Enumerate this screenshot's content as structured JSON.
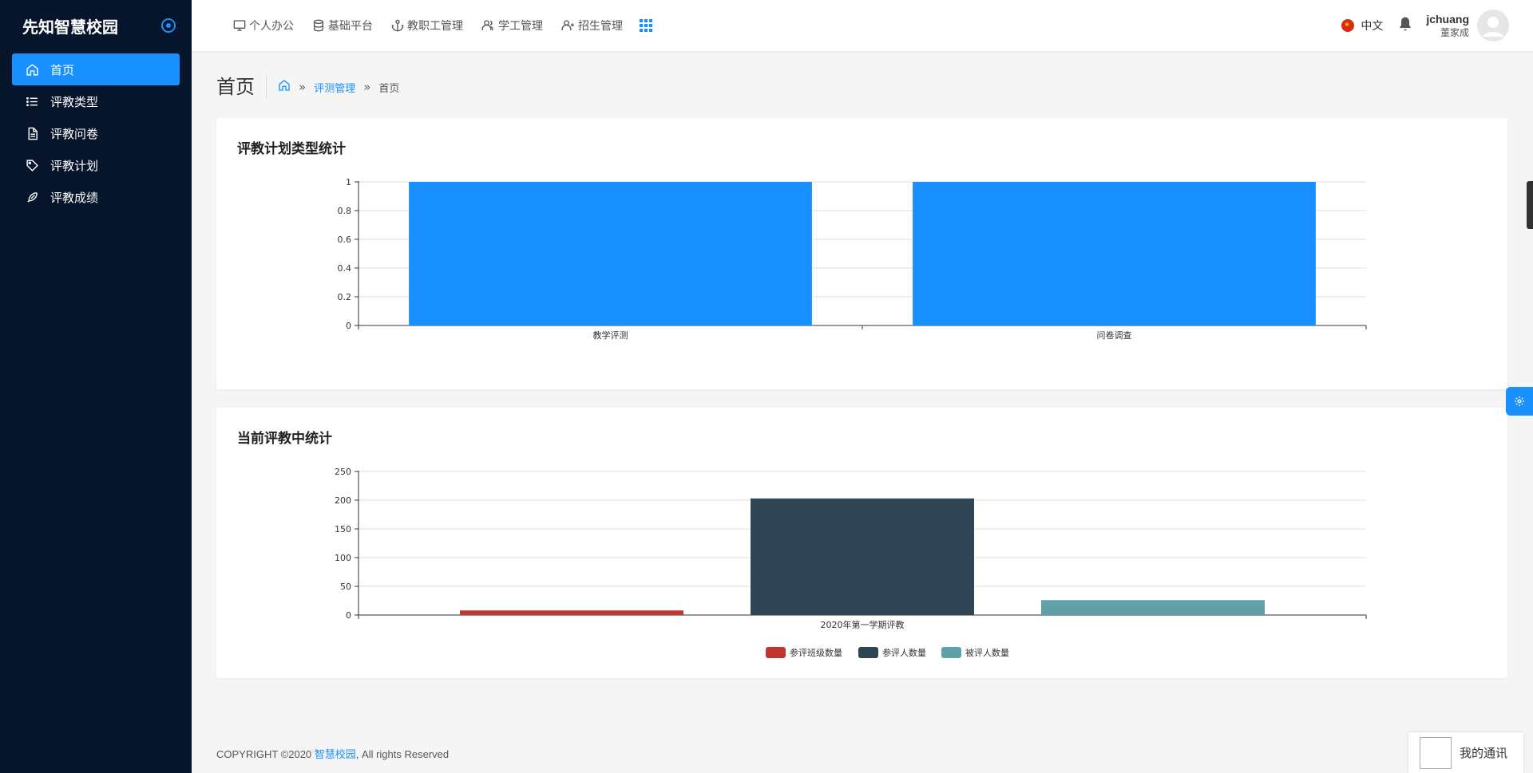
{
  "sidebar": {
    "brand": "先知智慧校园",
    "items": [
      {
        "label": "首页",
        "icon": "home-icon",
        "active": true
      },
      {
        "label": "评教类型",
        "icon": "list-icon",
        "active": false
      },
      {
        "label": "评教问卷",
        "icon": "document-icon",
        "active": false
      },
      {
        "label": "评教计划",
        "icon": "tag-icon",
        "active": false
      },
      {
        "label": "评教成绩",
        "icon": "feather-icon",
        "active": false
      }
    ]
  },
  "header": {
    "nav": [
      {
        "label": "个人办公",
        "icon": "desktop-icon"
      },
      {
        "label": "基础平台",
        "icon": "database-icon"
      },
      {
        "label": "教职工管理",
        "icon": "anchor-icon"
      },
      {
        "label": "学工管理",
        "icon": "users-icon"
      },
      {
        "label": "招生管理",
        "icon": "user-add-icon"
      }
    ],
    "language": "中文",
    "user": {
      "name": "jchuang",
      "display_name": "董家成"
    }
  },
  "page": {
    "title": "首页",
    "breadcrumb": {
      "parent": "评测管理",
      "current": "首页"
    }
  },
  "chart_data": [
    {
      "type": "bar",
      "title": "评教计划类型统计",
      "categories": [
        "教学评测",
        "问卷调查"
      ],
      "values": [
        1,
        1
      ],
      "ylim": [
        0,
        1
      ],
      "yticks": [
        "0",
        "0.2",
        "0.4",
        "0.6",
        "0.8",
        "1"
      ],
      "color": "#1890ff",
      "grid": true
    },
    {
      "type": "bar",
      "title": "当前评教中统计",
      "categories": [
        "2020年第一学期评教"
      ],
      "series": [
        {
          "name": "参评班级数量",
          "values": [
            8
          ],
          "color": "#c23531"
        },
        {
          "name": "参评人数量",
          "values": [
            203
          ],
          "color": "#2f4554"
        },
        {
          "name": "被评人数量",
          "values": [
            26
          ],
          "color": "#61a0a8"
        }
      ],
      "ylim": [
        0,
        250
      ],
      "yticks": [
        "0",
        "50",
        "100",
        "150",
        "200",
        "250"
      ],
      "legend": "bottom-center",
      "grid": true
    }
  ],
  "footer": {
    "prefix": "COPYRIGHT ©2020 ",
    "link": "智慧校园",
    "suffix": ", All rights Reserved"
  },
  "chat": {
    "label": "我的通讯"
  }
}
